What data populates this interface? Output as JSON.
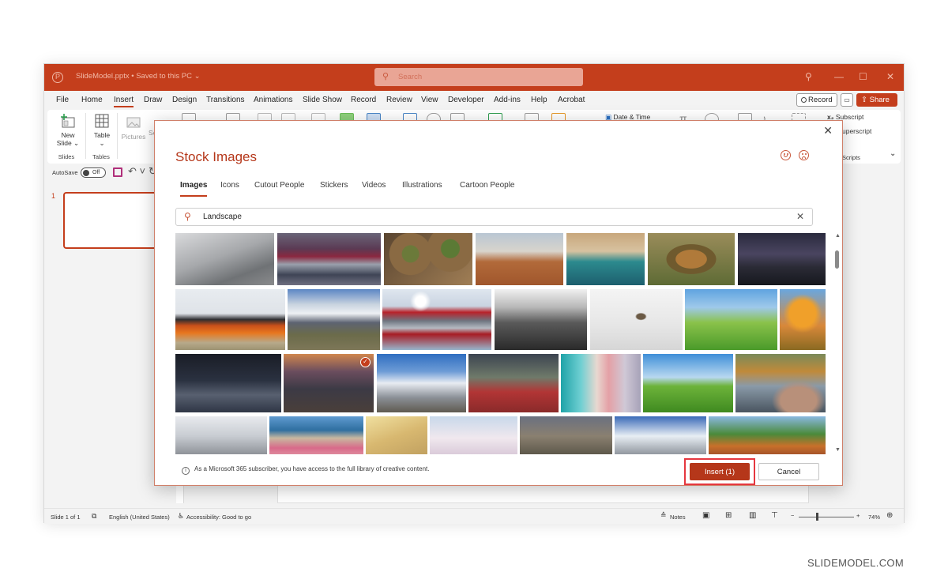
{
  "window": {
    "title": "SlideModel.pptx • Saved to this PC ⌄",
    "search_placeholder": "Search",
    "controls": [
      "⚲",
      "—",
      "☐",
      "✕"
    ]
  },
  "menu": {
    "tabs": [
      "File",
      "Home",
      "Insert",
      "Draw",
      "Design",
      "Transitions",
      "Animations",
      "Slide Show",
      "Record",
      "Review",
      "View",
      "Developer",
      "Add-ins",
      "Help",
      "Acrobat"
    ],
    "active_tab": "Insert",
    "record_label": "Record",
    "share_label": "Share ⌄"
  },
  "ribbon": {
    "new_slide": "New Slide ⌄",
    "slides_group": "Slides",
    "table": "Table",
    "table_caret": "⌄",
    "tables_group": "Tables",
    "pictures": "Pictures",
    "screenshot_partial": "Sc",
    "date_time": "Date & Time",
    "subscript": "Subscript",
    "superscript": "uperscript",
    "scripts_group": "Scripts",
    "expand": "⌄"
  },
  "qat": {
    "autosave": "AutoSave",
    "toggle": "Off"
  },
  "thumbnails": {
    "slide_number": "1"
  },
  "status": {
    "slide": "Slide 1 of 1",
    "language": "English (United States)",
    "accessibility": "Accessibility: Good to go",
    "notes": "Notes",
    "zoom_minus": "−",
    "zoom_plus": "+",
    "zoom_level": "74%"
  },
  "dialog": {
    "title": "Stock Images",
    "close": "✕",
    "tabs": [
      "Images",
      "Icons",
      "Cutout People",
      "Stickers",
      "Videos",
      "Illustrations",
      "Cartoon People"
    ],
    "active_tab": "Images",
    "search_value": "Landscape",
    "clear": "✕",
    "info_text": "As a Microsoft 365 subscriber, you have access to the full library of creative content.",
    "insert_label": "Insert (1)",
    "cancel_label": "Cancel",
    "selected_count": 1,
    "images": [
      {
        "desc": "Mountain road tunnel",
        "selected": false
      },
      {
        "desc": "Abstract red waves moon",
        "selected": false
      },
      {
        "desc": "Turf rolls",
        "selected": false
      },
      {
        "desc": "Monument Valley desert",
        "selected": false
      },
      {
        "desc": "Aerial beach",
        "selected": false
      },
      {
        "desc": "Volcanic crater",
        "selected": false
      },
      {
        "desc": "Milky way mountains",
        "selected": false
      },
      {
        "desc": "Abstract orange hills",
        "selected": false
      },
      {
        "desc": "Fitz Roy road",
        "selected": false
      },
      {
        "desc": "Abstract red reflection",
        "selected": false
      },
      {
        "desc": "Misty hills black white",
        "selected": false
      },
      {
        "desc": "Deer in snow",
        "selected": false
      },
      {
        "desc": "Green wheat field",
        "selected": false
      },
      {
        "desc": "Autumn tree",
        "selected": false
      },
      {
        "desc": "Dark dunes",
        "selected": false
      },
      {
        "desc": "Sunset peaks",
        "selected": true
      },
      {
        "desc": "Snowy mountain",
        "selected": false
      },
      {
        "desc": "Rainbow flower field",
        "selected": false
      },
      {
        "desc": "Aerial coast stripes",
        "selected": false
      },
      {
        "desc": "Wheat field blue sky",
        "selected": false
      },
      {
        "desc": "Fishing river",
        "selected": false
      },
      {
        "desc": "Snowy trees",
        "selected": false
      },
      {
        "desc": "Pink lake",
        "selected": false
      },
      {
        "desc": "Golden haze",
        "selected": false
      },
      {
        "desc": "Pastel snow dunes",
        "selected": false
      },
      {
        "desc": "Rocky tower",
        "selected": false
      },
      {
        "desc": "Snowy range",
        "selected": false
      },
      {
        "desc": "Autumn valley",
        "selected": false
      }
    ]
  },
  "colors": {
    "accent": "#c43e1c",
    "title": "#b5371a",
    "highlight": "#e5373f"
  },
  "watermark": "SLIDEMODEL.COM"
}
